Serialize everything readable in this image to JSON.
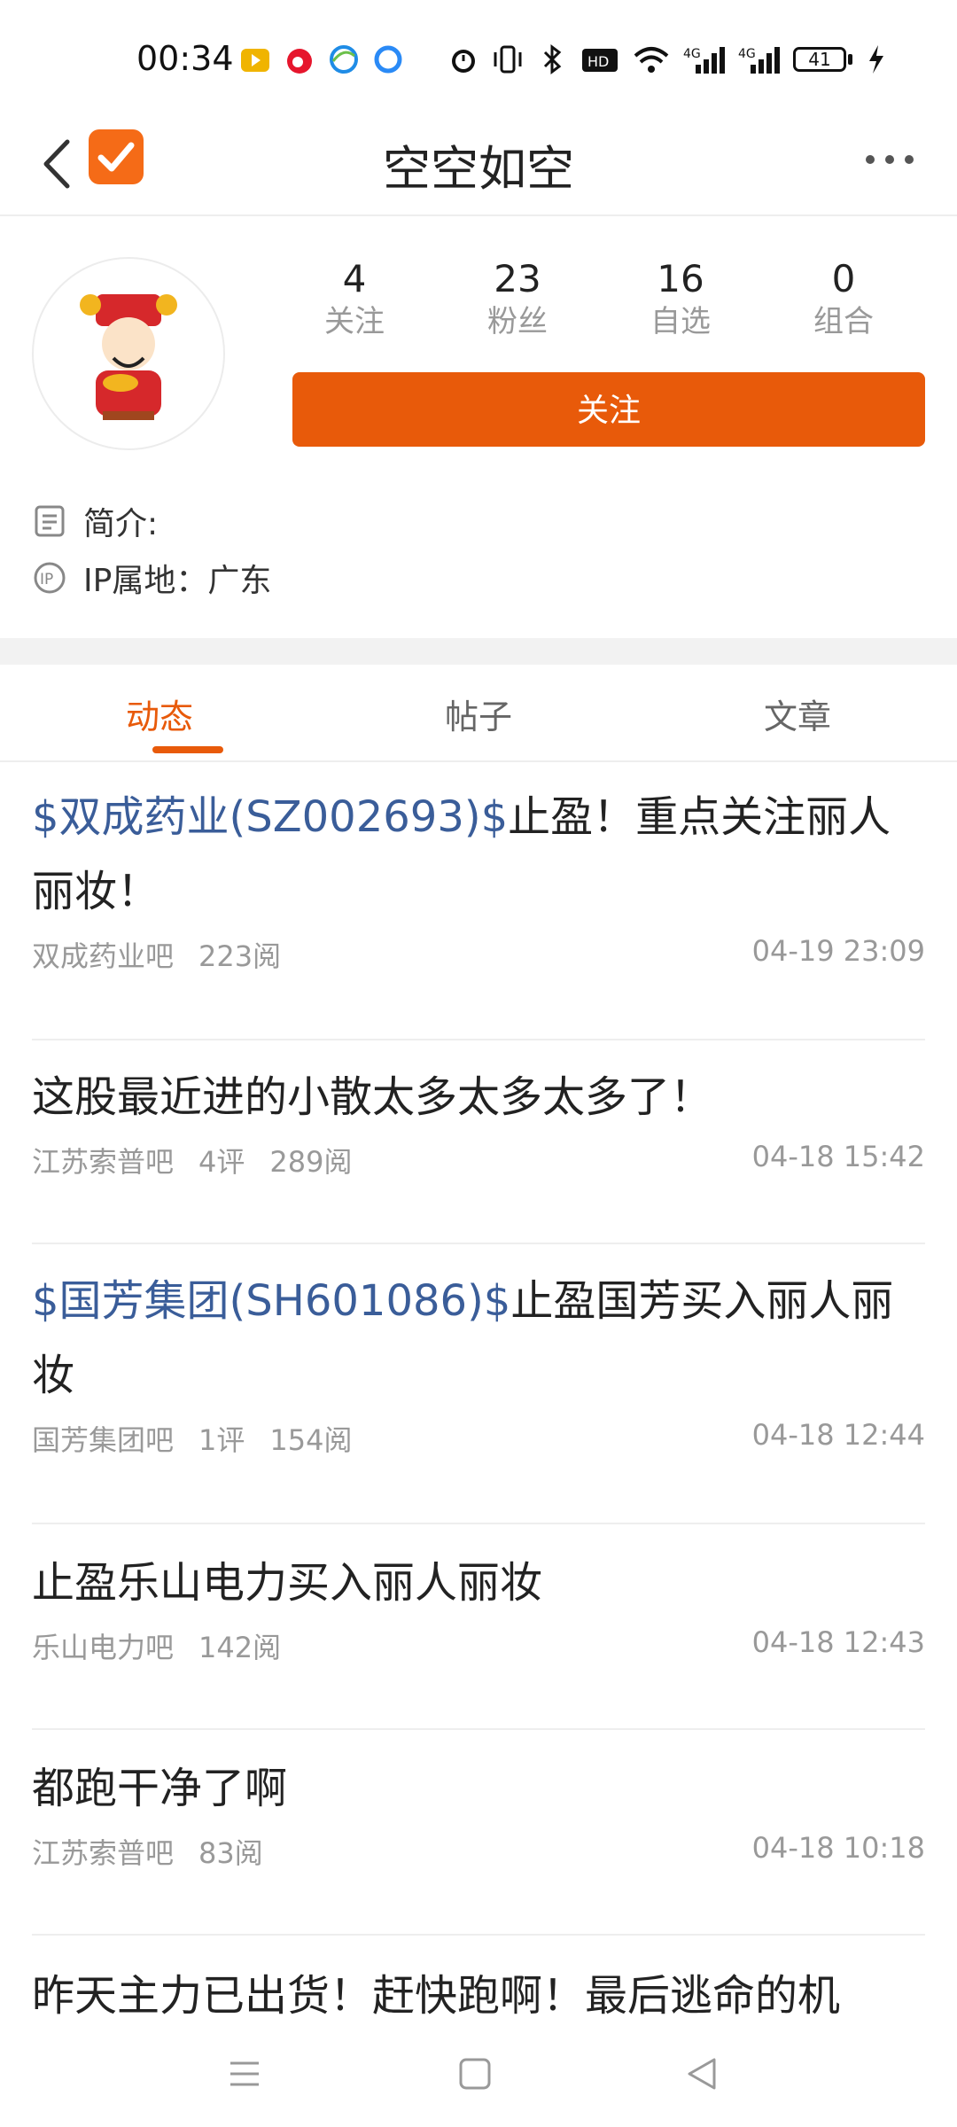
{
  "status_bar": {
    "time": "00:34",
    "battery": "41"
  },
  "header": {
    "title": "空空如空"
  },
  "profile": {
    "stats": [
      {
        "num": "4",
        "label": "关注"
      },
      {
        "num": "23",
        "label": "粉丝"
      },
      {
        "num": "16",
        "label": "自选"
      },
      {
        "num": "0",
        "label": "组合"
      }
    ],
    "follow_label": "关注",
    "bio_label": "简介:",
    "ip_label": "IP属地：广东"
  },
  "tabs": [
    {
      "label": "动态"
    },
    {
      "label": "帖子"
    },
    {
      "label": "文章"
    }
  ],
  "posts": [
    {
      "stock": "$双成药业(SZ002693)$",
      "text": "止盈！重点关注丽人丽妆！",
      "board": "双成药业吧",
      "comments": "",
      "reads": "223阅",
      "time": "04-19 23:09"
    },
    {
      "stock": "",
      "text": "这股最近进的小散太多太多太多了！",
      "board": "江苏索普吧",
      "comments": "4评",
      "reads": "289阅",
      "time": "04-18 15:42"
    },
    {
      "stock": "$国芳集团(SH601086)$",
      "text": "止盈国芳买入丽人丽妆",
      "board": "国芳集团吧",
      "comments": "1评",
      "reads": "154阅",
      "time": "04-18 12:44"
    },
    {
      "stock": "",
      "text": "止盈乐山电力买入丽人丽妆",
      "board": "乐山电力吧",
      "comments": "",
      "reads": "142阅",
      "time": "04-18 12:43"
    },
    {
      "stock": "",
      "text": "都跑干净了啊",
      "board": "江苏索普吧",
      "comments": "",
      "reads": "83阅",
      "time": "04-18 10:18"
    },
    {
      "stock": "",
      "text": "昨天主力已出货！赶快跑啊！最后逃命的机",
      "board": "",
      "comments": "",
      "reads": "",
      "time": ""
    }
  ],
  "icons": [
    "back-icon",
    "checkmark-logo-icon",
    "more-icon",
    "bio-icon",
    "ip-icon",
    "menu-icon",
    "home-icon",
    "back-nav-icon"
  ],
  "colors": {
    "accent": "#e85a0a",
    "stock_link": "#3a5d99"
  }
}
